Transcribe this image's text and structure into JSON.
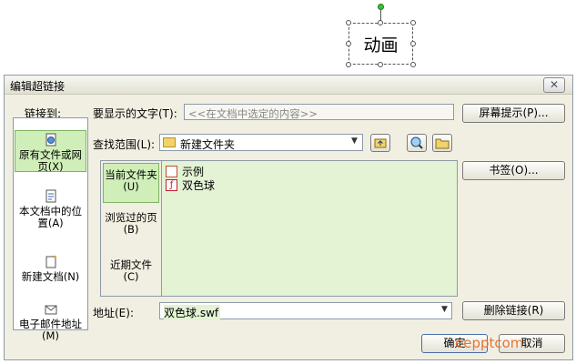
{
  "slide": {
    "shape_text": "动画"
  },
  "dialog": {
    "title": "编辑超链接",
    "close_glyph": "✕",
    "link_to_label": "链接到:",
    "display_text_label": "要显示的文字(T):",
    "display_text_value": "<<在文档中选定的内容>>",
    "screen_tip_button": "屏幕提示(P)...",
    "look_in_label": "查找范围(L):",
    "look_in_value": "新建文件夹",
    "bookmark_button": "书签(O)...",
    "address_label": "地址(E):",
    "address_value": "双色球.swf",
    "remove_link_button": "删除链接(R)",
    "ok_button": "确定",
    "cancel_button": "取消",
    "nav_items": [
      {
        "label": "原有文件或网页(X)"
      },
      {
        "label": "本文档中的位置(A)"
      },
      {
        "label": "新建文档(N)"
      },
      {
        "label": "电子邮件地址(M)"
      }
    ],
    "browse_tabs": [
      {
        "label": "当前文件夹(U)"
      },
      {
        "label": "浏览过的页(B)"
      },
      {
        "label": "近期文件(C)"
      }
    ],
    "files": [
      {
        "name": "示例",
        "icon": "ppt-file-icon"
      },
      {
        "name": "双色球",
        "icon": "flash-file-icon"
      }
    ]
  },
  "watermark": {
    "text": "eepptcom"
  }
}
